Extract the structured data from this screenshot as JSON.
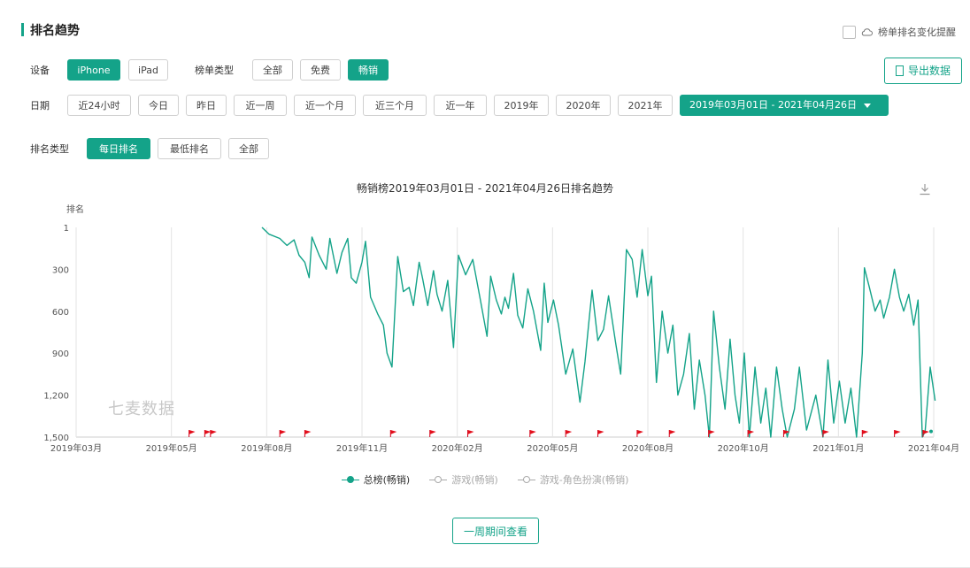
{
  "section": {
    "title": "排名趋势"
  },
  "toggle": {
    "label": "榜单排名变化提醒"
  },
  "device": {
    "label": "设备",
    "options": [
      {
        "label": "iPhone",
        "active": true
      },
      {
        "label": "iPad",
        "active": false
      }
    ]
  },
  "rank_kind": {
    "label": "榜单类型",
    "options": [
      {
        "label": "全部",
        "active": false
      },
      {
        "label": "免费",
        "active": false
      },
      {
        "label": "畅销",
        "active": true
      }
    ]
  },
  "export": {
    "label": "导出数据"
  },
  "date": {
    "label": "日期",
    "options": [
      {
        "label": "近24小时"
      },
      {
        "label": "今日"
      },
      {
        "label": "昨日"
      },
      {
        "label": "近一周"
      },
      {
        "label": "近一个月"
      },
      {
        "label": "近三个月"
      },
      {
        "label": "近一年"
      },
      {
        "label": "2019年"
      },
      {
        "label": "2020年"
      },
      {
        "label": "2021年"
      }
    ],
    "range_label": "2019年03月01日 - 2021年04月26日"
  },
  "ranking_type": {
    "label": "排名类型",
    "options": [
      {
        "label": "每日排名",
        "active": true
      },
      {
        "label": "最低排名",
        "active": false
      },
      {
        "label": "全部",
        "active": false
      }
    ]
  },
  "chart_data": {
    "type": "line",
    "title": "畅销榜2019年03月01日 - 2021年04月26日排名趋势",
    "ylabel": "排名",
    "y_ticks": [
      "1",
      "300",
      "600",
      "900",
      "1,200",
      "1,500"
    ],
    "ylim": [
      1,
      1500
    ],
    "y_inverted": true,
    "x_ticks": [
      "2019年03月",
      "2019年05月",
      "2019年08月",
      "2019年11月",
      "2020年02月",
      "2020年05月",
      "2020年08月",
      "2020年10月",
      "2021年01月",
      "2021年04月"
    ],
    "grid": true,
    "legend_position": "bottom",
    "series": [
      {
        "name": "总榜(畅销)",
        "color": "#14a389",
        "values": [
          [
            2.6,
            1
          ],
          [
            2.7,
            50
          ],
          [
            2.85,
            80
          ],
          [
            2.95,
            130
          ],
          [
            3.05,
            90
          ],
          [
            3.12,
            200
          ],
          [
            3.2,
            250
          ],
          [
            3.26,
            360
          ],
          [
            3.3,
            70
          ],
          [
            3.4,
            200
          ],
          [
            3.5,
            300
          ],
          [
            3.55,
            80
          ],
          [
            3.65,
            330
          ],
          [
            3.72,
            180
          ],
          [
            3.8,
            80
          ],
          [
            3.85,
            360
          ],
          [
            3.92,
            400
          ],
          [
            4.0,
            250
          ],
          [
            4.05,
            100
          ],
          [
            4.12,
            500
          ],
          [
            4.22,
            620
          ],
          [
            4.3,
            700
          ],
          [
            4.35,
            900
          ],
          [
            4.42,
            1000
          ],
          [
            4.5,
            210
          ],
          [
            4.58,
            460
          ],
          [
            4.66,
            430
          ],
          [
            4.72,
            560
          ],
          [
            4.8,
            250
          ],
          [
            4.85,
            370
          ],
          [
            4.92,
            560
          ],
          [
            5.0,
            310
          ],
          [
            5.05,
            480
          ],
          [
            5.12,
            600
          ],
          [
            5.2,
            380
          ],
          [
            5.28,
            860
          ],
          [
            5.35,
            200
          ],
          [
            5.45,
            340
          ],
          [
            5.55,
            230
          ],
          [
            5.65,
            500
          ],
          [
            5.75,
            780
          ],
          [
            5.8,
            350
          ],
          [
            5.88,
            520
          ],
          [
            5.95,
            620
          ],
          [
            6.0,
            500
          ],
          [
            6.05,
            580
          ],
          [
            6.12,
            330
          ],
          [
            6.18,
            630
          ],
          [
            6.25,
            720
          ],
          [
            6.32,
            440
          ],
          [
            6.4,
            600
          ],
          [
            6.5,
            880
          ],
          [
            6.55,
            400
          ],
          [
            6.6,
            680
          ],
          [
            6.68,
            520
          ],
          [
            6.75,
            700
          ],
          [
            6.85,
            1050
          ],
          [
            6.95,
            870
          ],
          [
            7.05,
            1250
          ],
          [
            7.12,
            960
          ],
          [
            7.18,
            650
          ],
          [
            7.22,
            450
          ],
          [
            7.3,
            810
          ],
          [
            7.38,
            730
          ],
          [
            7.45,
            490
          ],
          [
            7.55,
            830
          ],
          [
            7.62,
            1050
          ],
          [
            7.7,
            160
          ],
          [
            7.78,
            230
          ],
          [
            7.85,
            500
          ],
          [
            7.92,
            160
          ],
          [
            8.0,
            490
          ],
          [
            8.05,
            350
          ],
          [
            8.12,
            1110
          ],
          [
            8.2,
            600
          ],
          [
            8.28,
            900
          ],
          [
            8.35,
            700
          ],
          [
            8.42,
            1200
          ],
          [
            8.5,
            1050
          ],
          [
            8.58,
            760
          ],
          [
            8.65,
            1300
          ],
          [
            8.72,
            950
          ],
          [
            8.8,
            1200
          ],
          [
            8.86,
            1500
          ],
          [
            8.92,
            600
          ],
          [
            9.0,
            1000
          ],
          [
            9.08,
            1300
          ],
          [
            9.15,
            800
          ],
          [
            9.22,
            1200
          ],
          [
            9.28,
            1400
          ],
          [
            9.35,
            900
          ],
          [
            9.42,
            1500
          ],
          [
            9.5,
            1000
          ],
          [
            9.58,
            1400
          ],
          [
            9.65,
            1150
          ],
          [
            9.72,
            1500
          ],
          [
            9.8,
            1000
          ],
          [
            9.88,
            1300
          ],
          [
            9.95,
            1500
          ],
          [
            10.05,
            1300
          ],
          [
            10.12,
            1000
          ],
          [
            10.22,
            1450
          ],
          [
            10.35,
            1200
          ],
          [
            10.45,
            1500
          ],
          [
            10.52,
            950
          ],
          [
            10.6,
            1400
          ],
          [
            10.68,
            1100
          ],
          [
            10.76,
            1400
          ],
          [
            10.84,
            1150
          ],
          [
            10.92,
            1500
          ],
          [
            11.0,
            900
          ],
          [
            11.03,
            290
          ],
          [
            11.1,
            430
          ],
          [
            11.18,
            600
          ],
          [
            11.25,
            520
          ],
          [
            11.3,
            650
          ],
          [
            11.38,
            500
          ],
          [
            11.45,
            300
          ],
          [
            11.52,
            500
          ],
          [
            11.58,
            600
          ],
          [
            11.65,
            480
          ],
          [
            11.72,
            700
          ],
          [
            11.78,
            520
          ],
          [
            11.84,
            1500
          ],
          [
            11.88,
            1460
          ],
          [
            11.95,
            1000
          ],
          [
            12.02,
            1240
          ]
        ]
      },
      {
        "name": "游戏(畅销)",
        "color": "#bbbbbb",
        "values": []
      },
      {
        "name": "游戏-角色扮演(畅销)",
        "color": "#bbbbbb",
        "values": []
      }
    ],
    "event_flags": [
      1.58,
      1.8,
      1.88,
      2.85,
      3.2,
      4.4,
      4.95,
      5.48,
      6.35,
      6.85,
      7.3,
      7.85,
      8.3,
      8.85,
      9.4,
      9.9,
      10.45,
      11.0,
      11.45,
      11.85
    ]
  },
  "watermark": {
    "text": "七麦数据"
  },
  "compare": {
    "label": "一周期间查看"
  }
}
